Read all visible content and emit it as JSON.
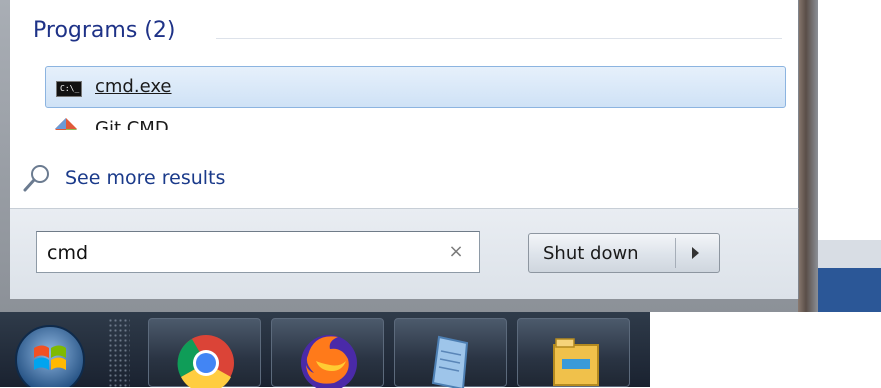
{
  "results": {
    "group_header": "Programs (2)",
    "items": [
      {
        "label": "cmd.exe",
        "icon": "cmd-icon",
        "selected": true
      },
      {
        "label": "Git CMD",
        "icon": "git-icon",
        "partially_visible": true
      }
    ],
    "see_more": "See more results"
  },
  "search": {
    "value": "cmd",
    "clear_symbol": "×"
  },
  "power": {
    "shutdown_label": "Shut down"
  },
  "taskbar": {
    "apps": [
      {
        "name": "chrome-icon"
      },
      {
        "name": "firefox-icon"
      },
      {
        "name": "notepad-icon"
      },
      {
        "name": "file-explorer-icon"
      }
    ]
  },
  "colors": {
    "group_header": "#1e3287",
    "selection_border": "#8cb4e0",
    "taskbar": "#1a2230"
  }
}
